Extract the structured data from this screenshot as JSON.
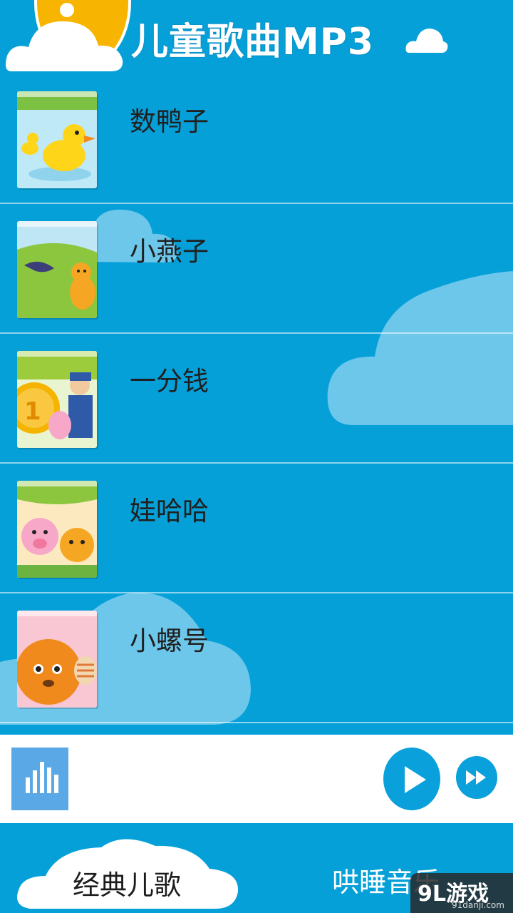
{
  "header": {
    "title": "儿童歌曲MP3"
  },
  "songs": [
    {
      "title": "数鸭子",
      "thumb": "duck"
    },
    {
      "title": "小燕子",
      "thumb": "swallow"
    },
    {
      "title": "一分钱",
      "thumb": "coin"
    },
    {
      "title": "娃哈哈",
      "thumb": "pigs"
    },
    {
      "title": "小螺号",
      "thumb": "conch"
    }
  ],
  "player": {
    "equalizer_icon": "equalizer-icon",
    "play_icon": "play-icon",
    "next_icon": "fast-forward-icon"
  },
  "tabs": [
    {
      "label": "经典儿歌",
      "selected": true
    },
    {
      "label": "哄睡音乐",
      "selected": false
    }
  ],
  "watermark": {
    "logo": "9L游戏",
    "url": "91danji.com"
  },
  "colors": {
    "background": "#06a0d9",
    "sun": "#f7b400",
    "player_bg": "#ffffff",
    "button": "#0aa0dc"
  }
}
